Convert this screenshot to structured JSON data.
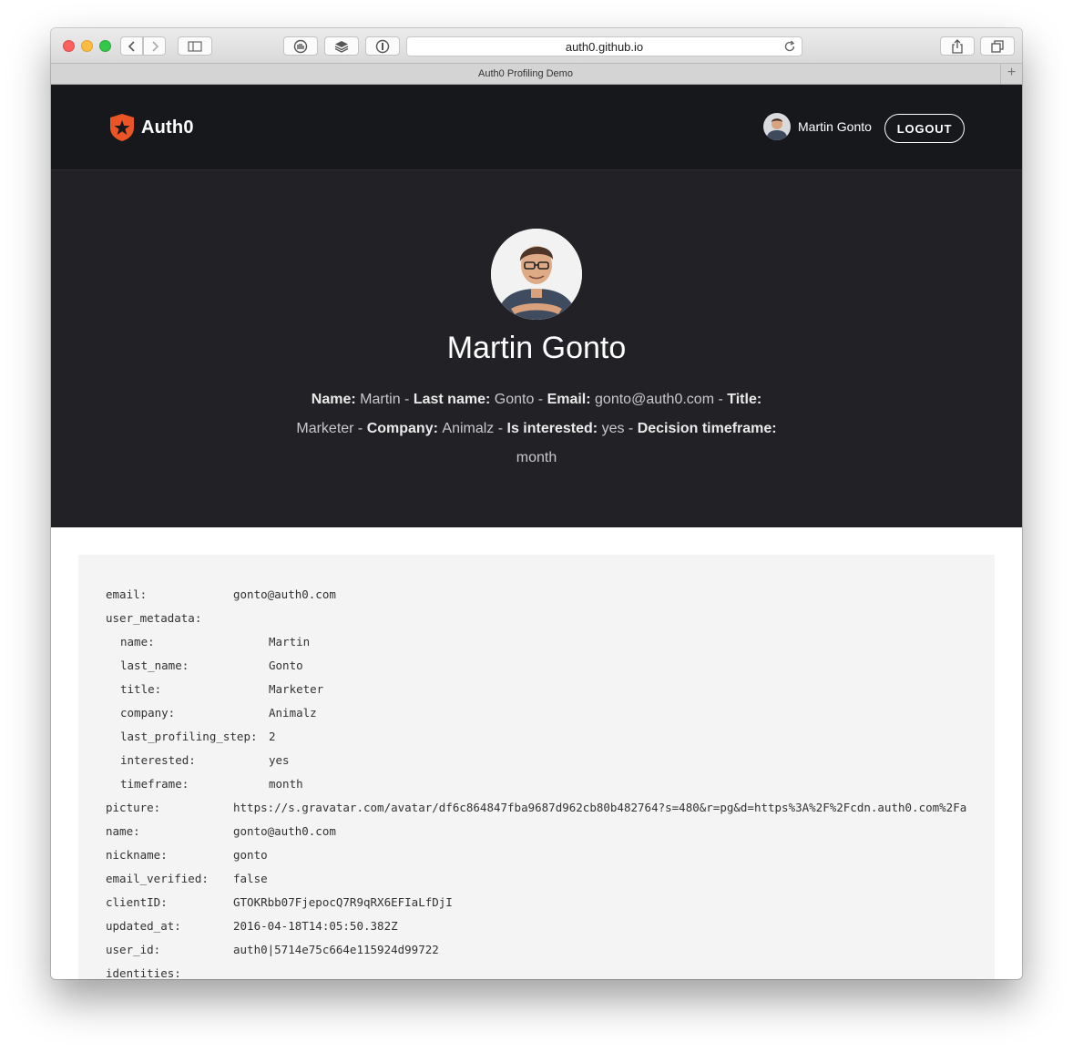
{
  "browser": {
    "url": "auth0.github.io",
    "tab_title": "Auth0 Profiling Demo",
    "new_tab_symbol": "+"
  },
  "navbar": {
    "logo_text": "Auth0",
    "user_name": "Martin Gonto",
    "logout_label": "LOGOUT"
  },
  "profile": {
    "full_name": "Martin Gonto",
    "fields": [
      {
        "label": "Name:",
        "value": "Martin"
      },
      {
        "label": "Last name:",
        "value": "Gonto"
      },
      {
        "label": "Email:",
        "value": "gonto@auth0.com"
      },
      {
        "label": "Title:",
        "value": "Marketer"
      },
      {
        "label": "Company:",
        "value": "Animalz"
      },
      {
        "label": "Is interested:",
        "value": "yes"
      },
      {
        "label": "Decision timeframe:",
        "value": "month"
      }
    ],
    "separator": " - "
  },
  "json_view": {
    "rows": [
      {
        "key": "email:",
        "value": "gonto@auth0.com",
        "indent": false
      },
      {
        "key": "user_metadata:",
        "value": "",
        "indent": false
      },
      {
        "key": "name:",
        "value": "Martin",
        "indent": true
      },
      {
        "key": "last_name:",
        "value": "Gonto",
        "indent": true
      },
      {
        "key": "title:",
        "value": "Marketer",
        "indent": true
      },
      {
        "key": "company:",
        "value": "Animalz",
        "indent": true
      },
      {
        "key": "last_profiling_step:",
        "value": "2",
        "indent": true
      },
      {
        "key": "interested:",
        "value": "yes",
        "indent": true
      },
      {
        "key": "timeframe:",
        "value": "month",
        "indent": true
      },
      {
        "key": "picture:",
        "value": "https://s.gravatar.com/avatar/df6c864847fba9687d962cb80b482764?s=480&r=pg&d=https%3A%2F%2Fcdn.auth0.com%2Fa",
        "indent": false
      },
      {
        "key": "name:",
        "value": "gonto@auth0.com",
        "indent": false
      },
      {
        "key": "nickname:",
        "value": "gonto",
        "indent": false
      },
      {
        "key": "email_verified:",
        "value": "false",
        "indent": false
      },
      {
        "key": "clientID:",
        "value": "GTOKRbb07FjepocQ7R9qRX6EFIaLfDjI",
        "indent": false
      },
      {
        "key": "updated_at:",
        "value": "2016-04-18T14:05:50.382Z",
        "indent": false
      },
      {
        "key": "user_id:",
        "value": "auth0|5714e75c664e115924d99722",
        "indent": false
      },
      {
        "key": "identities:",
        "value": "",
        "indent": false
      }
    ]
  },
  "colors": {
    "navbar_bg": "#16181c",
    "hero_bg": "#222226",
    "brand": "#eb5424",
    "code_bg": "#f4f4f4"
  },
  "icons": [
    "back-icon",
    "forward-icon",
    "sidebar-icon",
    "extension-icon",
    "layers-icon",
    "info-icon",
    "reload-icon",
    "share-icon",
    "tabs-icon",
    "auth0-shield-icon"
  ]
}
